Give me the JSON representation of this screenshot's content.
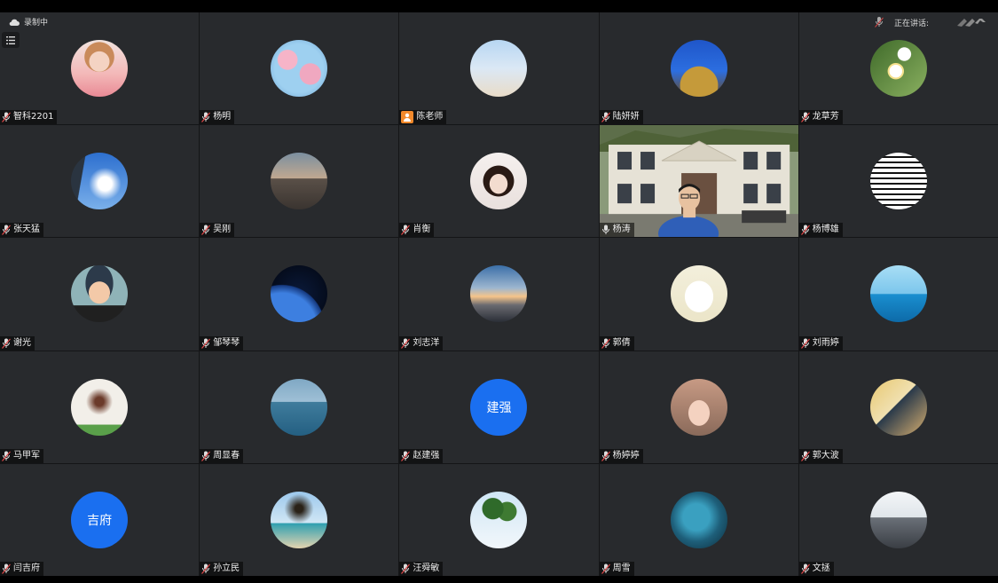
{
  "overlay": {
    "recording_label": "录制中",
    "speaking_label": "正在讲话:"
  },
  "colors": {
    "tile_bg": "#282a2d",
    "accent_blue": "#1a6ff0",
    "host_orange": "#f2892b"
  },
  "participants": [
    {
      "name": "智科2201",
      "avatar": "photo-girl-pink",
      "mic": "muted"
    },
    {
      "name": "杨明",
      "avatar": "photo-blossom-sky",
      "mic": "muted"
    },
    {
      "name": "陈老师",
      "avatar": "photo-family-beach",
      "mic": "host"
    },
    {
      "name": "陆妍妍",
      "avatar": "photo-castle-blue",
      "mic": "muted"
    },
    {
      "name": "龙草芳",
      "avatar": "photo-white-flowers",
      "mic": "muted"
    },
    {
      "name": "张天猛",
      "avatar": "photo-clouds-window",
      "mic": "muted"
    },
    {
      "name": "吴刚",
      "avatar": "photo-railway",
      "mic": "muted"
    },
    {
      "name": "肖衡",
      "avatar": "photo-woman-portrait",
      "mic": "muted"
    },
    {
      "name": "杨涛",
      "avatar": "video-live",
      "mic": "active"
    },
    {
      "name": "杨博雄",
      "avatar": "photo-qr-code",
      "mic": "muted"
    },
    {
      "name": "谢光",
      "avatar": "cartoon-boy-glasses",
      "mic": "muted"
    },
    {
      "name": "邹琴琴",
      "avatar": "photo-earth-space",
      "mic": "muted"
    },
    {
      "name": "刘志洋",
      "avatar": "photo-sunset-sky",
      "mic": "muted"
    },
    {
      "name": "郭倩",
      "avatar": "cartoon-cat",
      "mic": "muted"
    },
    {
      "name": "刘雨婷",
      "avatar": "photo-sea-figure",
      "mic": "muted"
    },
    {
      "name": "马甲军",
      "avatar": "photo-bare-tree",
      "mic": "muted"
    },
    {
      "name": "周显春",
      "avatar": "photo-sea-horizon",
      "mic": "muted"
    },
    {
      "name": "赵建强",
      "avatar": "initials",
      "initials": "建强",
      "mic": "muted"
    },
    {
      "name": "杨婷婷",
      "avatar": "photo-child-bunny",
      "mic": "muted"
    },
    {
      "name": "郭大波",
      "avatar": "photo-beach-collage",
      "mic": "muted"
    },
    {
      "name": "闫吉府",
      "avatar": "initials",
      "initials": "吉府",
      "mic": "muted"
    },
    {
      "name": "孙立民",
      "avatar": "photo-tree-beach",
      "mic": "muted"
    },
    {
      "name": "汪舜敏",
      "avatar": "photo-palm-trees",
      "mic": "muted"
    },
    {
      "name": "周雪",
      "avatar": "photo-blue-planet",
      "mic": "muted"
    },
    {
      "name": "文拯",
      "avatar": "photo-person-mountain",
      "mic": "muted"
    }
  ]
}
